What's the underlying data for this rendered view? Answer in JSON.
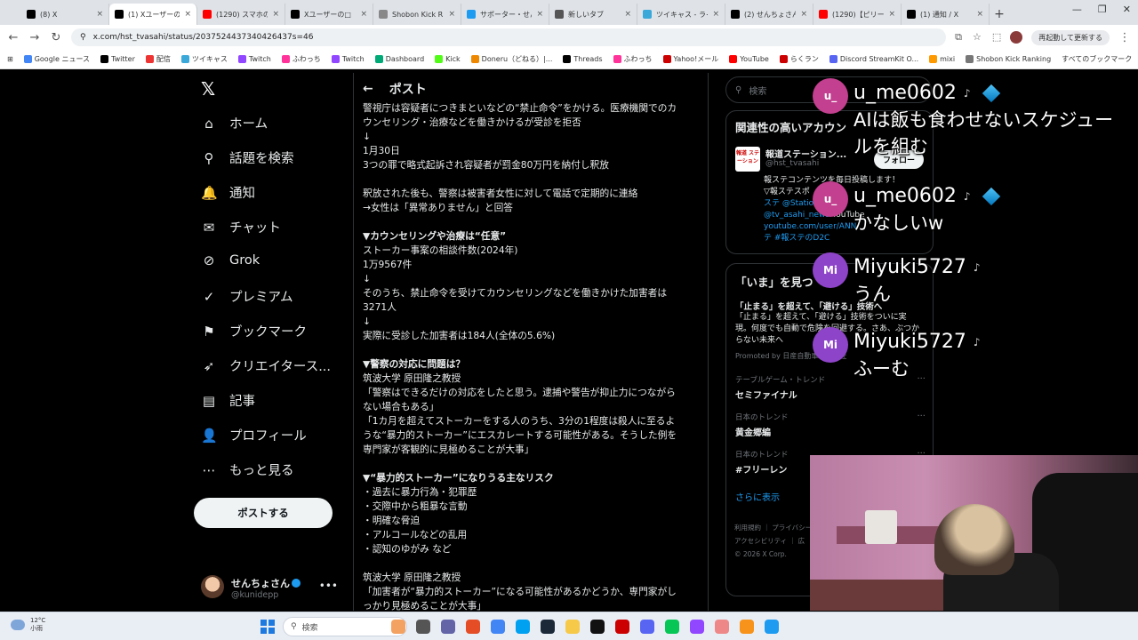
{
  "browser": {
    "tabs": [
      {
        "title": "(8) X",
        "color": "#000000"
      },
      {
        "title": "(1) Xユーザーの新",
        "color": "#000000",
        "active": true
      },
      {
        "title": "(1290) スマホの",
        "color": "#ff0000"
      },
      {
        "title": "Xユーザーの□",
        "color": "#000000"
      },
      {
        "title": "Shobon Kick R",
        "color": "#888888"
      },
      {
        "title": "サポーター・せん",
        "color": "#1d9bf0"
      },
      {
        "title": "新しいタブ",
        "color": "#555555"
      },
      {
        "title": "ツイキャス - ライ",
        "color": "#3aa8d8"
      },
      {
        "title": "(2) せんちょさん",
        "color": "#000000"
      },
      {
        "title": "(1290)【ピリーズ",
        "color": "#ff0000"
      },
      {
        "title": "(1) 通知 / X",
        "color": "#000000"
      }
    ],
    "new_tab": "+",
    "url": "x.com/hst_tvasahi/status/2037524437340426437s=46",
    "relaunch": "再起動して更新する",
    "bookmarks": [
      "Google ニュース",
      "Twitter",
      "配信",
      "ツイキャス",
      "Twitch",
      "ふわっち",
      "Twitch",
      "Dashboard",
      "Kick",
      "Doneru（どねる）|...",
      "Threads",
      "ふわっち",
      "Yahoo!メール",
      "YouTube",
      "らくラン",
      "Discord StreamKit O...",
      "mixi",
      "Shobon Kick Ranking"
    ],
    "all_bookmarks": "すべてのブックマーク"
  },
  "nav": {
    "items": [
      "ホーム",
      "話題を検索",
      "通知",
      "チャット",
      "Grok",
      "プレミアム",
      "ブックマーク",
      "クリエイタース...",
      "記事",
      "プロフィール",
      "もっと見る"
    ],
    "post_button": "ポストする",
    "account_name": "せんちょさん",
    "account_handle": "@kunidepp"
  },
  "main": {
    "back": "←",
    "title": "ポスト",
    "lines": [
      "警視庁は容疑者につきまといなどの“禁止命令”をかける。医療機関でのカ",
      "ウンセリング・治療などを働きかけるが受診を拒否",
      "↓",
      "1月30日",
      "3つの罪で略式起訴され容疑者が罰金80万円を納付し釈放",
      "",
      "釈放された後も、警察は被害者女性に対して電話で定期的に連絡",
      "→女性は「異常ありません」と回答",
      "",
      "▼カウンセリングや治療は“任意”",
      "ストーカー事案の相談件数(2024年)",
      "1万9567件",
      "↓",
      "そのうち、禁止命令を受けてカウンセリングなどを働きかけた加害者は",
      "3271人",
      "↓",
      "実際に受診した加害者は184人(全体の5.6%)",
      "",
      "▼警察の対応に問題は？",
      "筑波大学 原田隆之教授",
      "「警察はできるだけの対応をしたと思う。逮捕や警告が抑止力につながら",
      "ない場合もある」",
      "「1カ月を超えてストーカーをする人のうち、3分の1程度は殺人に至るよ",
      "うな“暴力的ストーカー”にエスカレートする可能性がある。そうした例を",
      "専門家が客観的に見極めることが大事」",
      "",
      "▼“暴力的ストーカー”になりうる主なリスク",
      "・過去に暴力行為・犯罪歴",
      "・交際中から粗暴な言動",
      "・明確な脅迫",
      "・アルコールなどの乱用",
      "・認知のゆがみ など",
      "",
      "筑波大学 原田隆之教授",
      "「加害者が“暴力的ストーカー”になる可能性があるかどうか、専門家がし",
      "っかり見極めることが大事」"
    ]
  },
  "right": {
    "search_placeholder": "検索",
    "related_title": "関連性の高いアカウン",
    "account_name": "報道ステーション...",
    "account_handle": "@hst_tvasahi",
    "account_logo": "報道 ステーション",
    "bio_1": "報ステコンテンツを毎日投稿します！",
    "bio_2": "▽報ステスポ",
    "bio_3": "ステ @Station",
    "bio_4": "@tv_asahi_news",
    "bio_5": "YouTube",
    "bio_6": "youtube.com/user/ANN",
    "bio_7": "テ #報ステのD2C",
    "follow": "フォロー",
    "now_title": "「いま」を見つ",
    "promo_title": "「止まる」を超えて、「避ける」技術へ",
    "promo_text": "「止まる」を超えて、「避ける」技術をついに実現。何度でも自動で危険を回避する。さあ、ぶつからない未来へ",
    "promo_by": "Promoted by 日産自動車株式会社",
    "trends": [
      {
        "category": "テーブルゲーム・トレンド",
        "name": "セミファイナル"
      },
      {
        "category": "日本のトレンド",
        "name": "黄金郷編"
      },
      {
        "category": "日本のトレンド",
        "name": "#フリーレン"
      }
    ],
    "show_more": "さらに表示",
    "footer_1": "利用規約 ｜ プライバシー",
    "footer_2": "アクセシビリティ ｜ 広",
    "footer_3": "© 2026 X Corp."
  },
  "chat": [
    {
      "avatar": "u_",
      "name": "u_me0602",
      "message": "AIは飯も食わせないスケジュールを組む",
      "color": "#c2408f",
      "badge": true
    },
    {
      "avatar": "u_",
      "name": "u_me0602",
      "message": "かなしいw",
      "color": "#c2408f",
      "badge": true
    },
    {
      "avatar": "Mi",
      "name": "Miyuki5727",
      "message": "うん",
      "color": "#8e44c8",
      "badge": false
    },
    {
      "avatar": "Mi",
      "name": "Miyuki5727",
      "message": "ふーむ",
      "color": "#8e44c8",
      "badge": false
    }
  ],
  "taskbar": {
    "temp": "12°C",
    "weather": "小雨",
    "search": "検索"
  }
}
